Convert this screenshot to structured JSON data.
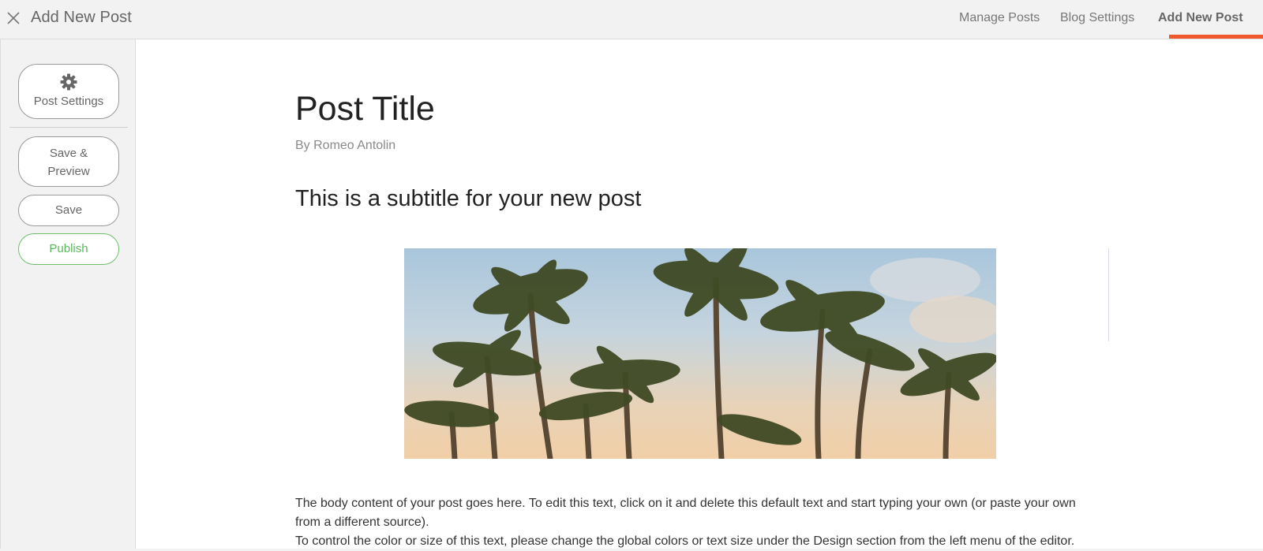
{
  "header": {
    "title": "Add New Post",
    "nav": [
      {
        "label": "Manage Posts"
      },
      {
        "label": "Blog Settings"
      },
      {
        "label": "Add New Post",
        "active": true
      }
    ],
    "accent_color": "#f0582e"
  },
  "sidebar": {
    "settings_label": "Post Settings",
    "settings_icon": "gear-icon",
    "preview_label_line1": "Save &",
    "preview_label_line2": "Preview",
    "save_label": "Save",
    "publish_label": "Publish",
    "publish_color": "#5cb85c"
  },
  "post": {
    "title": "Post Title",
    "byline": "By Romeo Antolin",
    "subtitle": "This is a subtitle for your new post",
    "hero_image": "palm-trees-photo",
    "body_line1": "The body content of your post goes here. To edit this text, click on it and delete this default text and start typing your own (or paste your own from a different source).",
    "body_line2": "To control the color or size of this text, please change the global colors or text size under the Design section from the left menu of the editor."
  }
}
